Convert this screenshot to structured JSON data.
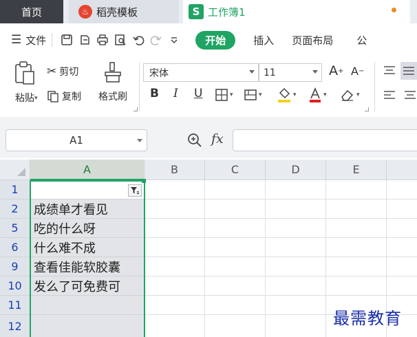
{
  "tabs": {
    "home": "首页",
    "template": "稻壳模板",
    "workbook": "工作簿1",
    "template_icon_glyph": "♨",
    "workbook_icon_glyph": "S"
  },
  "menu": {
    "hamburger_glyph": "☰",
    "file": "文件",
    "start": "开始",
    "insert": "插入",
    "page_layout": "页面布局",
    "more": "公"
  },
  "ribbon": {
    "paste": "粘贴",
    "cut": "剪切",
    "copy": "复制",
    "format_painter": "格式刷",
    "font_name": "宋体",
    "font_size": "11",
    "bold": "B",
    "italic": "I",
    "underline": "U",
    "grow_font": "A",
    "shrink_font": "A"
  },
  "formula_bar": {
    "name_box": "A1",
    "fx": "fx",
    "formula_value": ""
  },
  "sheet": {
    "columns": [
      "A",
      "B",
      "C",
      "D",
      "E"
    ],
    "rows": [
      {
        "num": "1",
        "value": ""
      },
      {
        "num": "2",
        "value": "成绩单才看见"
      },
      {
        "num": "5",
        "value": "吃的什么呀"
      },
      {
        "num": "6",
        "value": "什么难不成"
      },
      {
        "num": "9",
        "value": "查看佳能软胶囊"
      },
      {
        "num": "10",
        "value": "发么了可免费可"
      },
      {
        "num": "11",
        "value": ""
      },
      {
        "num": "12",
        "value": ""
      }
    ]
  },
  "watermark": "最需教育",
  "colors": {
    "accent": "#1fa463",
    "row_number": "#1a3fb3"
  }
}
